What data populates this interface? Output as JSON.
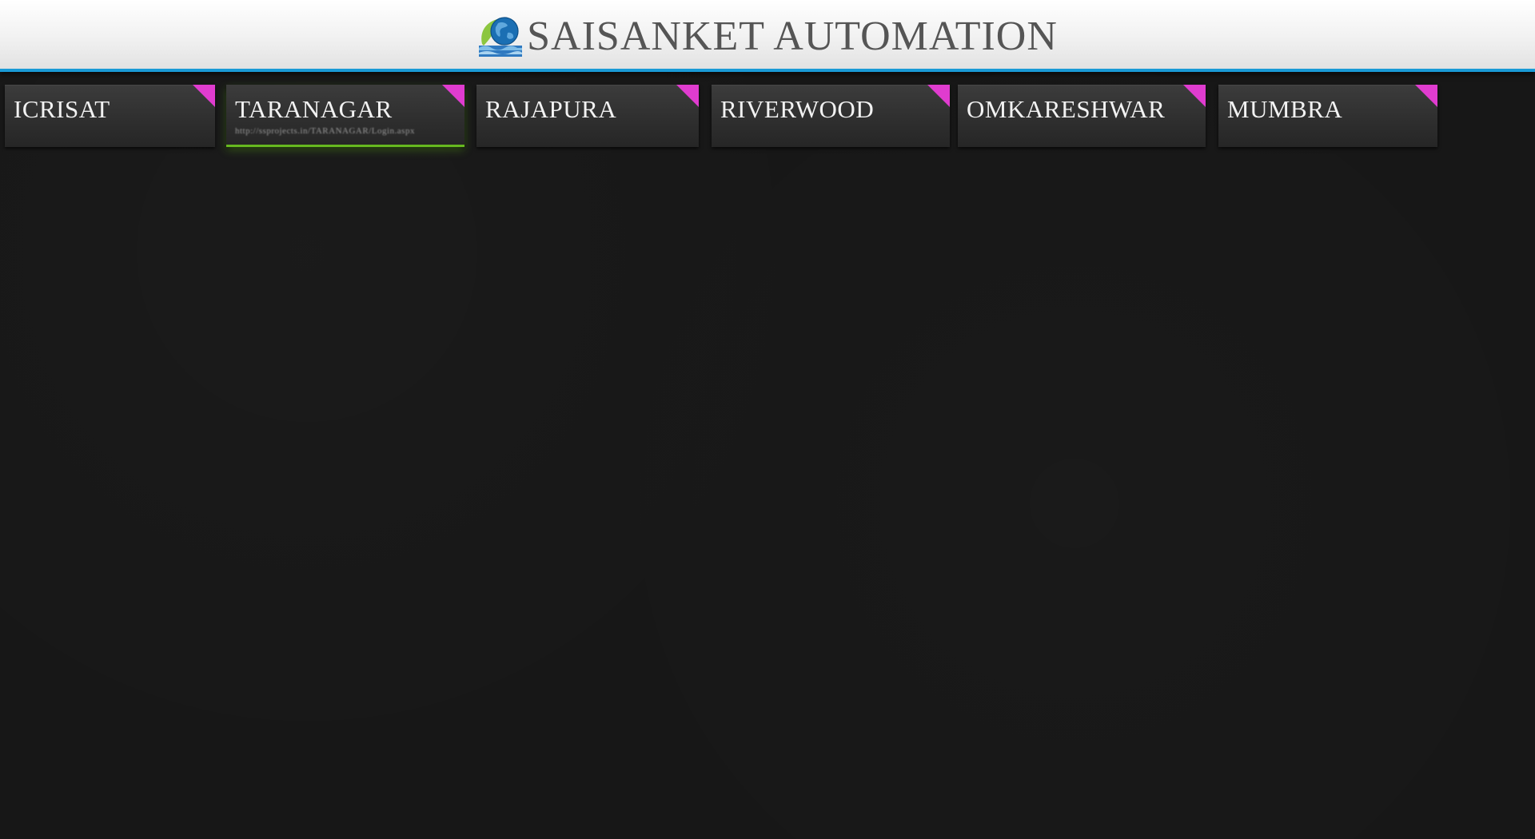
{
  "header": {
    "brand_title": "SAISANKET AUTOMATION",
    "logo_icon": "globe-leaf-logo-icon",
    "accent_color": "#1a9ad6"
  },
  "tabs": [
    {
      "label": "ICRISAT",
      "url": "",
      "active": false
    },
    {
      "label": "TARANAGAR",
      "url": "http://ssprojects.in/TARANAGAR/Login.aspx",
      "active": true
    },
    {
      "label": "RAJAPURA",
      "url": "",
      "active": false
    },
    {
      "label": "RIVERWOOD",
      "url": "",
      "active": false
    },
    {
      "label": "OMKARESHWAR",
      "url": "",
      "active": false
    },
    {
      "label": "MUMBRA",
      "url": "",
      "active": false
    }
  ],
  "colors": {
    "corner_badge": "#e03ccf",
    "active_underline": "#66b81f",
    "background": "#171717"
  }
}
